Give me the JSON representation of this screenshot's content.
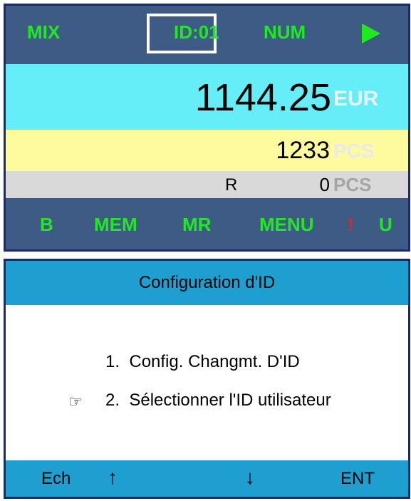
{
  "top_screen": {
    "header": {
      "mode": "MIX",
      "id": "ID:01",
      "num": "NUM",
      "play_icon": "play-icon"
    },
    "amount": {
      "value": "1144.25",
      "unit": "EUR"
    },
    "pieces": {
      "value": "1233",
      "unit": "PCS"
    },
    "reject": {
      "label": "R",
      "value": "0",
      "unit": "PCS"
    },
    "footer": {
      "b": "B",
      "mem": "MEM",
      "mr": "MR",
      "menu": "MENU",
      "alert": "!",
      "u": "U"
    },
    "colors": {
      "accent_green": "#1eeb1e",
      "bar_blue": "#3e5b85",
      "alert_red": "#ff1a1a"
    }
  },
  "config_screen": {
    "title": "Configuration d'ID",
    "items": [
      {
        "number": "1.",
        "label": "Config. Changmt. D'ID"
      },
      {
        "number": "2.",
        "label": "Sélectionner l'ID utilisateur",
        "selected": true
      }
    ],
    "pointer_glyph": "☞",
    "softkeys": {
      "back": "Ech",
      "up": "↑",
      "down": "↓",
      "enter": "ENT"
    }
  }
}
